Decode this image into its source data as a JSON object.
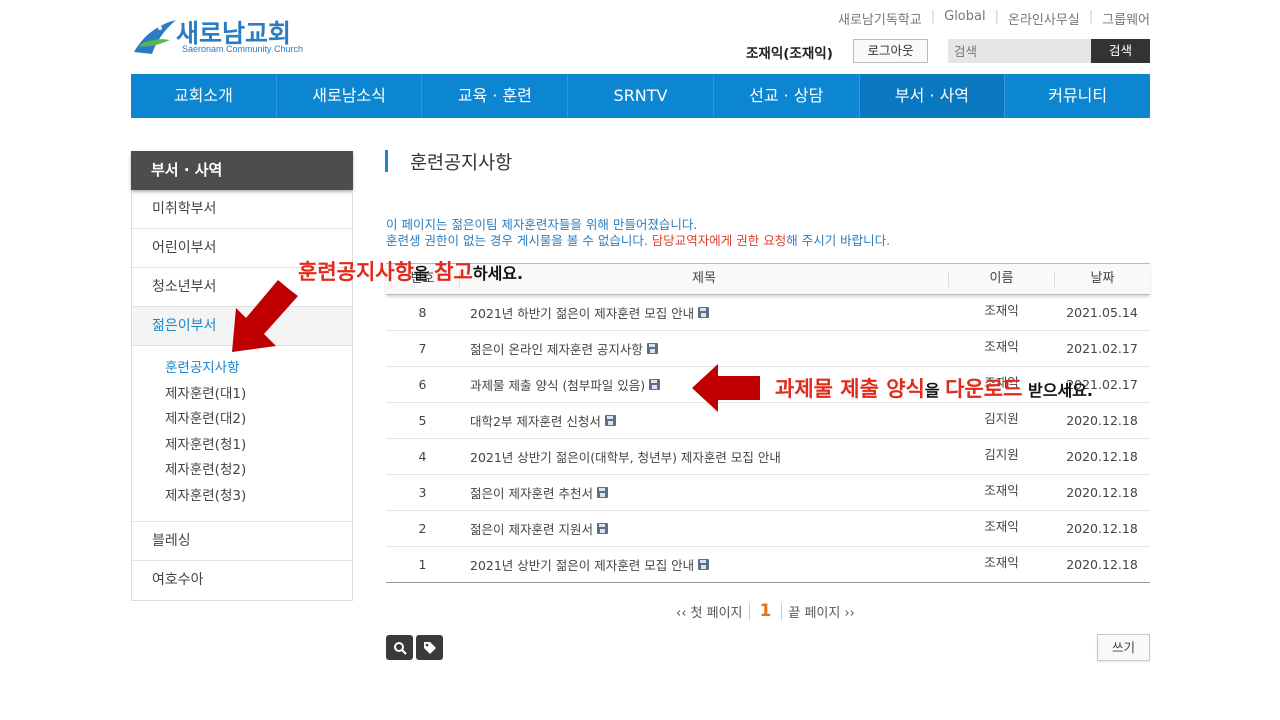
{
  "brand": {
    "name_ko": "새로남교회",
    "name_en": "Saeronam Community Church"
  },
  "util_links": [
    "새로남기독학교",
    "Global",
    "온라인사무실",
    "그룹웨어"
  ],
  "user": {
    "name": "조재익(조재익)",
    "logout_label": "로그아웃"
  },
  "search": {
    "placeholder": "검색",
    "button_label": "검색"
  },
  "gnb": [
    "교회소개",
    "새로남소식",
    "교육 · 훈련",
    "SRNTV",
    "선교 · 상담",
    "부서 · 사역",
    "커뮤니티"
  ],
  "sidebar": {
    "title": "부서 · 사역",
    "items": [
      "미취학부서",
      "어린이부서",
      "청소년부서",
      "젊은이부서"
    ],
    "sub_items": [
      "훈련공지사항",
      "제자훈련(대1)",
      "제자훈련(대2)",
      "제자훈련(청1)",
      "제자훈련(청2)",
      "제자훈련(청3)"
    ],
    "bottom_items": [
      "블레싱",
      "여호수아"
    ]
  },
  "page": {
    "title": "훈련공지사항",
    "notice_line1": "이 페이지는 젊은이팀 제자훈련자들을 위해 만들어졌습니다.",
    "notice_line2_a": "훈련생 권한이 없는 경우 게시물을 볼 수 없습니다. ",
    "notice_line2_b": "담당교역자에게 권한 요청",
    "notice_line2_c": "해 주시기 바랍니다."
  },
  "board": {
    "headers": {
      "no": "번호",
      "title": "제목",
      "name": "이름",
      "date": "날짜"
    },
    "rows": [
      {
        "no": "8",
        "title": "2021년 하반기 젊은이 제자훈련 모집 안내",
        "name": "조재익",
        "date": "2021.05.14",
        "attach": true
      },
      {
        "no": "7",
        "title": "젊은이 온라인 제자훈련 공지사항",
        "name": "조재익",
        "date": "2021.02.17",
        "attach": true
      },
      {
        "no": "6",
        "title": "과제물 제출 양식 (첨부파일 있음)",
        "name": "조재익",
        "date": "2021.02.17",
        "attach": true
      },
      {
        "no": "5",
        "title": "대학2부 제자훈련 신청서",
        "name": "김지원",
        "date": "2020.12.18",
        "attach": true
      },
      {
        "no": "4",
        "title": "2021년 상반기 젊은이(대학부, 청년부) 제자훈련 모집 안내",
        "name": "김지원",
        "date": "2020.12.18",
        "attach": false
      },
      {
        "no": "3",
        "title": "젊은이 제자훈련 추천서",
        "name": "조재익",
        "date": "2020.12.18",
        "attach": true
      },
      {
        "no": "2",
        "title": "젊은이 제자훈련 지원서",
        "name": "조재익",
        "date": "2020.12.18",
        "attach": true
      },
      {
        "no": "1",
        "title": "2021년 상반기 젊은이 제자훈련 모집 안내",
        "name": "조재익",
        "date": "2020.12.18",
        "attach": true
      }
    ]
  },
  "pager": {
    "first": "‹‹ 첫 페이지",
    "current": "1",
    "last": "끝 페이지 ››"
  },
  "write_label": "쓰기",
  "annotations": {
    "a1_hl1": "훈련공지사항",
    "a1_t1": "을 ",
    "a1_hl2": "참고",
    "a1_t2": "하세요.",
    "a2_hl1": "과제물 제출 양식",
    "a2_t1": "을 ",
    "a2_hl2": "다운로드",
    "a2_t2": " 받으세요."
  },
  "colors": {
    "primary": "#0d86d1",
    "accent_red": "#e3291b",
    "arrow": "#c00000",
    "sidebar_head": "#4d4d4d"
  }
}
